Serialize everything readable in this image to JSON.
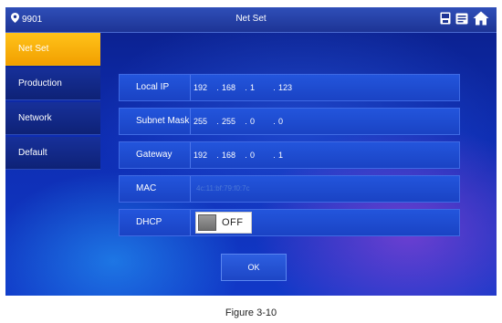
{
  "topbar": {
    "room_number": "9901",
    "title": "Net Set",
    "icons": [
      "location-pin-icon",
      "sd-card-icon",
      "message-icon",
      "home-icon"
    ]
  },
  "sidebar": {
    "items": [
      {
        "label": "Net Set",
        "active": true
      },
      {
        "label": "Production",
        "active": false
      },
      {
        "label": "Network",
        "active": false
      },
      {
        "label": "Default",
        "active": false
      }
    ]
  },
  "form": {
    "local_ip": {
      "label": "Local IP",
      "octets": [
        "192",
        "168",
        "1",
        "123"
      ]
    },
    "subnet_mask": {
      "label": "Subnet Mask",
      "octets": [
        "255",
        "255",
        "0",
        "0"
      ]
    },
    "gateway": {
      "label": "Gateway",
      "octets": [
        "192",
        "168",
        "0",
        "1"
      ]
    },
    "mac": {
      "label": "MAC",
      "value": "4c:11:bf:79:f0:7c"
    },
    "dhcp": {
      "label": "DHCP",
      "state": "OFF"
    }
  },
  "ok_label": "OK",
  "caption": "Figure 3-10",
  "colors": {
    "active_tab": "#f5a800",
    "background": "#0e2db2",
    "row_background": "#1f4cd2"
  }
}
